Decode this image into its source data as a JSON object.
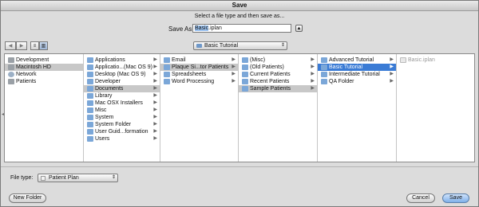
{
  "window": {
    "title": "Save"
  },
  "prompt": "Select a file type and then save as...",
  "save_as": {
    "label": "Save As:",
    "value_selected": "Basic",
    "value_rest": ".iplan"
  },
  "toolbar": {
    "back_icon": "chevron-left-icon",
    "forward_icon": "chevron-right-icon",
    "path_popup": "Basic Tutorial"
  },
  "columns": [
    {
      "items": [
        {
          "label": "Development",
          "icon": "drive",
          "state": "normal"
        },
        {
          "label": "Macintosh HD",
          "icon": "drive",
          "state": "sel"
        },
        {
          "label": "Network",
          "icon": "globe",
          "state": "normal"
        },
        {
          "label": "Patients",
          "icon": "drive",
          "state": "normal"
        }
      ]
    },
    {
      "items": [
        {
          "label": "Applications",
          "icon": "folder",
          "state": "normal",
          "child": true
        },
        {
          "label": "Applicatio...(Mac OS 9)",
          "icon": "folder",
          "state": "normal",
          "child": true
        },
        {
          "label": "Desktop (Mac OS 9)",
          "icon": "folder",
          "state": "normal",
          "child": true
        },
        {
          "label": "Developer",
          "icon": "folder",
          "state": "normal",
          "child": true
        },
        {
          "label": "Documents",
          "icon": "folder",
          "state": "sel",
          "child": true
        },
        {
          "label": "Library",
          "icon": "folder",
          "state": "normal",
          "child": true
        },
        {
          "label": "Mac OSX Installers",
          "icon": "folder",
          "state": "normal",
          "child": true
        },
        {
          "label": "Misc",
          "icon": "folder",
          "state": "normal",
          "child": true
        },
        {
          "label": "System",
          "icon": "folder",
          "state": "normal",
          "child": true
        },
        {
          "label": "System Folder",
          "icon": "folder",
          "state": "normal",
          "child": true
        },
        {
          "label": "User Guid...formation",
          "icon": "folder",
          "state": "normal",
          "child": true
        },
        {
          "label": "Users",
          "icon": "folder",
          "state": "normal",
          "child": true
        }
      ]
    },
    {
      "items": [
        {
          "label": "Email",
          "icon": "folder",
          "state": "normal",
          "child": true
        },
        {
          "label": "Plaque Si...tor Patients",
          "icon": "folder",
          "state": "sel",
          "child": true
        },
        {
          "label": "Spreadsheets",
          "icon": "folder",
          "state": "normal",
          "child": true
        },
        {
          "label": "Word Processing",
          "icon": "folder",
          "state": "normal",
          "child": true
        }
      ]
    },
    {
      "items": [
        {
          "label": "(Misc)",
          "icon": "folder",
          "state": "normal",
          "child": true
        },
        {
          "label": "(Old Patients)",
          "icon": "folder",
          "state": "normal",
          "child": true
        },
        {
          "label": "Current Patients",
          "icon": "folder",
          "state": "normal",
          "child": true
        },
        {
          "label": "Recent Patients",
          "icon": "folder",
          "state": "normal",
          "child": true
        },
        {
          "label": "Sample Patients",
          "icon": "folder",
          "state": "sel",
          "child": true
        }
      ]
    },
    {
      "items": [
        {
          "label": "Advanced Tutorial",
          "icon": "folder",
          "state": "normal",
          "child": true
        },
        {
          "label": "Basic Tutorial",
          "icon": "folder",
          "state": "selblue",
          "child": true
        },
        {
          "label": "Intermediate Tutorial",
          "icon": "folder",
          "state": "normal",
          "child": true
        },
        {
          "label": "QA Folder",
          "icon": "folder",
          "state": "normal",
          "child": true
        }
      ]
    },
    {
      "items": [
        {
          "label": "Basic.iplan",
          "icon": "doc2",
          "state": "dim",
          "child": false
        }
      ]
    }
  ],
  "file_type": {
    "label": "File type:",
    "value": "Patient Plan"
  },
  "buttons": {
    "new_folder": "New Folder",
    "cancel": "Cancel",
    "save": "Save"
  }
}
